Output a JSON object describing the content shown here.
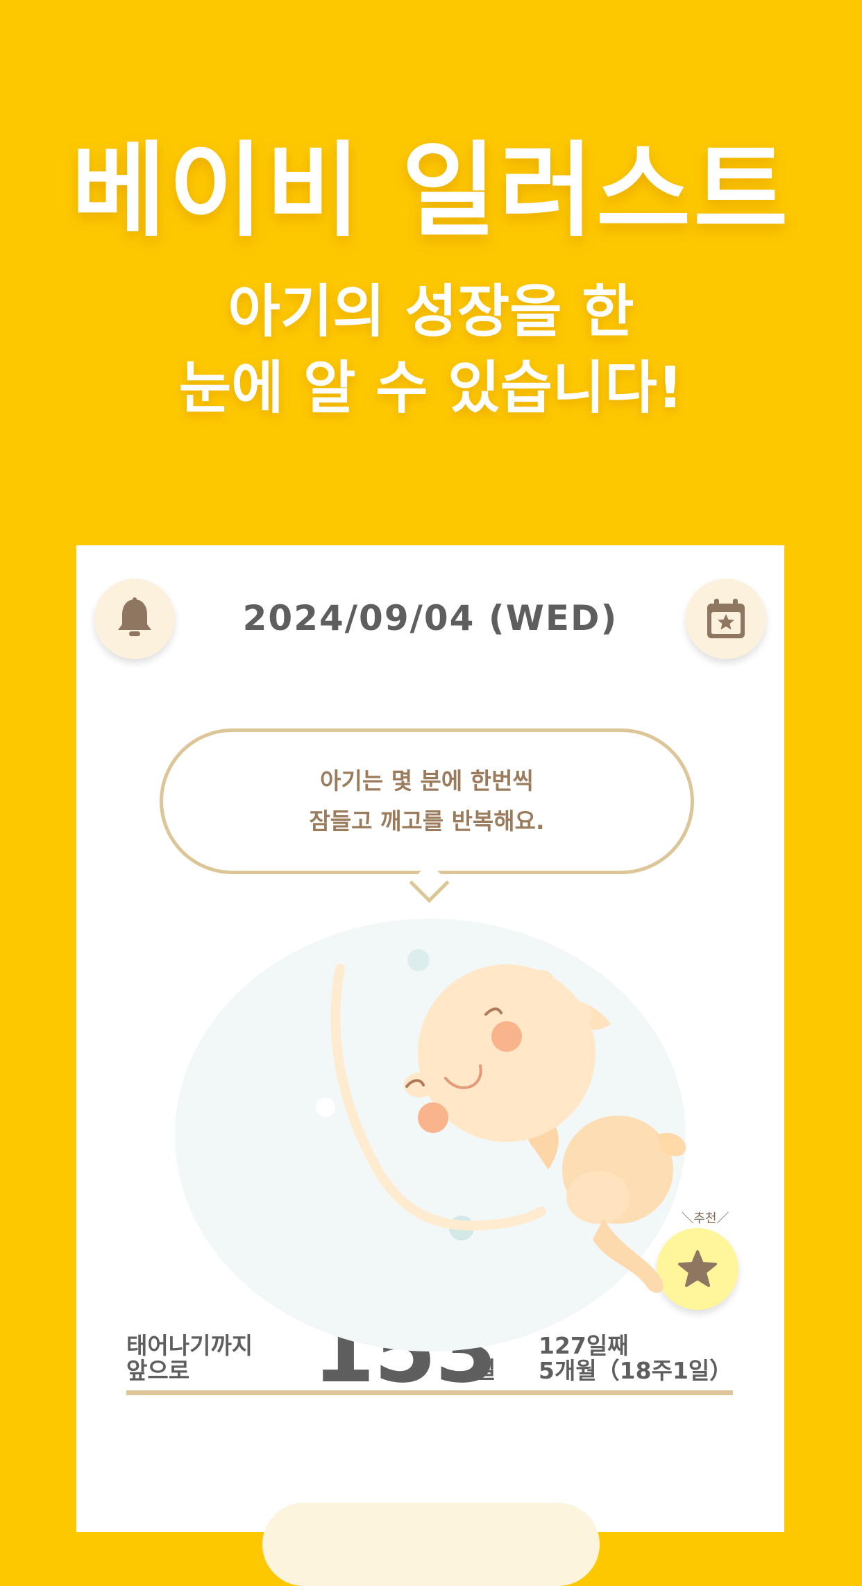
{
  "headline": "베이비 일러스트",
  "subline": [
    "아기의 성장을 한",
    "눈에 알 수 있습니다!"
  ],
  "card": {
    "date": "2024/09/04 (WED)",
    "bubble_lines": [
      "아기는 몇 분에 한번씩",
      "잠들고 깨고를 반복해요."
    ],
    "recommend_label": "＼추천／",
    "countdown_label_lines": [
      "태어나기까지",
      "앞으로"
    ],
    "countdown_number": "153",
    "countdown_unit": "일",
    "age_lines": [
      "127일째",
      "5개월（18주1일）"
    ]
  },
  "icons": {
    "bell": "bell-icon",
    "calendar": "calendar-star-icon",
    "recommend": "star-icon"
  },
  "colors": {
    "background": "#FDC800",
    "card": "#FFFFFF",
    "accent_beige": "#DCC597",
    "icon_brown": "#8E7660",
    "text_gray": "#5E5E5E",
    "bubble_text": "#9A7B5C",
    "recommend_yellow": "#FFF59A"
  }
}
